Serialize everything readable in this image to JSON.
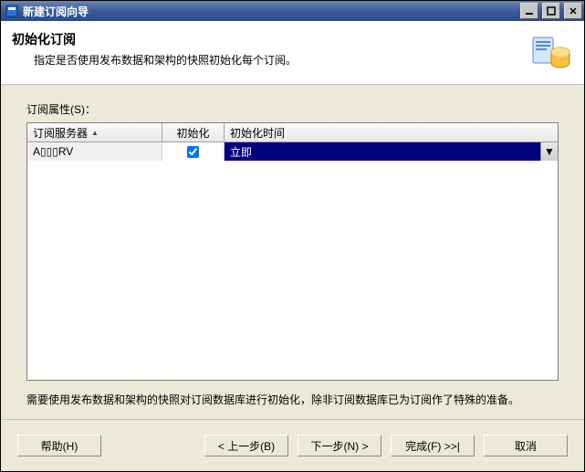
{
  "window": {
    "title": "新建订阅向导"
  },
  "header": {
    "title": "初始化订阅",
    "description": "指定是否使用发布数据和架构的快照初始化每个订阅。"
  },
  "body": {
    "propsLabel": "订阅属性(S)：",
    "columns": {
      "server": "订阅服务器",
      "init": "初始化",
      "initTime": "初始化时间"
    },
    "row": {
      "server": "A▯▯▯RV",
      "initChecked": true,
      "initTimeSelected": "立即"
    },
    "note": "需要使用发布数据和架构的快照对订阅数据库进行初始化，除非订阅数据库已为订阅作了特殊的准备。"
  },
  "footer": {
    "help": "帮助(H)",
    "back": "< 上一步(B)",
    "next": "下一步(N) >",
    "finish": "完成(F) >>|",
    "cancel": "取消"
  }
}
